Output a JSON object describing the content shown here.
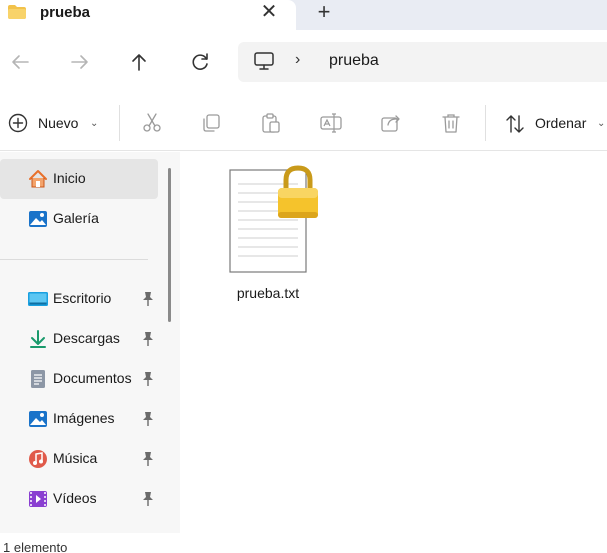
{
  "window": {
    "tab_title": "prueba",
    "close_glyph": "✕",
    "new_tab_glyph": "+"
  },
  "address_bar": {
    "path_segment": "prueba",
    "separator": "›"
  },
  "command_bar": {
    "new_label": "Nuevo",
    "sort_label": "Ordenar",
    "icons": [
      "cut-icon",
      "copy-icon",
      "paste-icon",
      "rename-icon",
      "share-icon",
      "delete-icon"
    ]
  },
  "sidebar": {
    "items": [
      {
        "label": "Inicio",
        "icon": "home-icon",
        "color": "#e8702a"
      },
      {
        "label": "Galería",
        "icon": "gallery-icon",
        "color": "#1a73c9"
      },
      {
        "label": "Escritorio",
        "icon": "desktop-icon",
        "color": "#1aa0e0",
        "pinned": true
      },
      {
        "label": "Descargas",
        "icon": "downloads-icon",
        "color": "#1a9a6c",
        "pinned": true
      },
      {
        "label": "Documentos",
        "icon": "documents-icon",
        "color": "#7a8596",
        "pinned": true
      },
      {
        "label": "Imágenes",
        "icon": "pictures-icon",
        "color": "#1a73c9",
        "pinned": true
      },
      {
        "label": "Música",
        "icon": "music-icon",
        "color": "#e05a4a",
        "pinned": true
      },
      {
        "label": "Vídeos",
        "icon": "videos-icon",
        "color": "#8a3fd1",
        "pinned": true
      }
    ]
  },
  "content": {
    "files": [
      {
        "name": "prueba.txt",
        "icon": "locked-text-file-icon"
      }
    ]
  },
  "status_bar": {
    "item_count": "1 elemento"
  }
}
